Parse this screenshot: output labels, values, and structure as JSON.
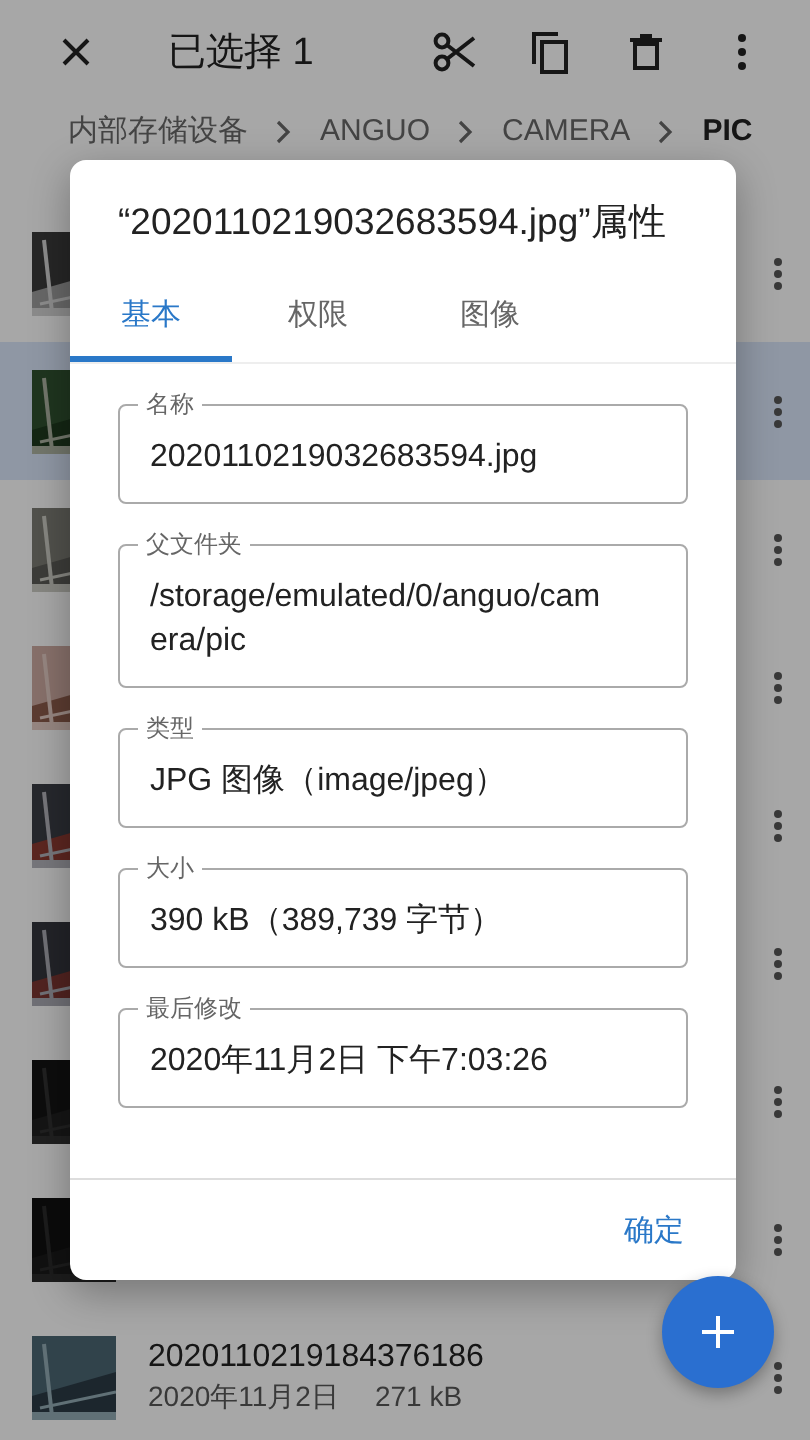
{
  "app_bar": {
    "title": "已选择 1"
  },
  "breadcrumb": [
    {
      "label": "内部存储设备"
    },
    {
      "label": "ANGUO"
    },
    {
      "label": "CAMERA"
    },
    {
      "label": "PIC"
    }
  ],
  "files": [
    {
      "selected": false
    },
    {
      "selected": true
    },
    {
      "selected": false
    },
    {
      "selected": false
    },
    {
      "selected": false
    },
    {
      "selected": false
    },
    {
      "selected": false
    },
    {
      "selected": false
    },
    {
      "selected": false,
      "name": "2020110219184376186",
      "date": "2020年11月2日",
      "size": "271 kB"
    }
  ],
  "dialog": {
    "title": "“20201102190326835​94.jpg”属性",
    "tabs": [
      {
        "label": "基本",
        "selected": true
      },
      {
        "label": "权限",
        "selected": false
      },
      {
        "label": "图像",
        "selected": false
      }
    ],
    "fields": [
      {
        "label": "名称",
        "value": "20201102190326835​94.jpg"
      },
      {
        "label": "父文件夹",
        "value": "/storage/emulated/0/anguo/camera/pic"
      },
      {
        "label": "类型",
        "value": "JPG 图像（image/jpeg）"
      },
      {
        "label": "大小",
        "value": "390 kB（389,739 字节）"
      },
      {
        "label": "最后修改",
        "value": "2020年11月2日 下午7:03:26"
      }
    ],
    "button": "确定"
  }
}
